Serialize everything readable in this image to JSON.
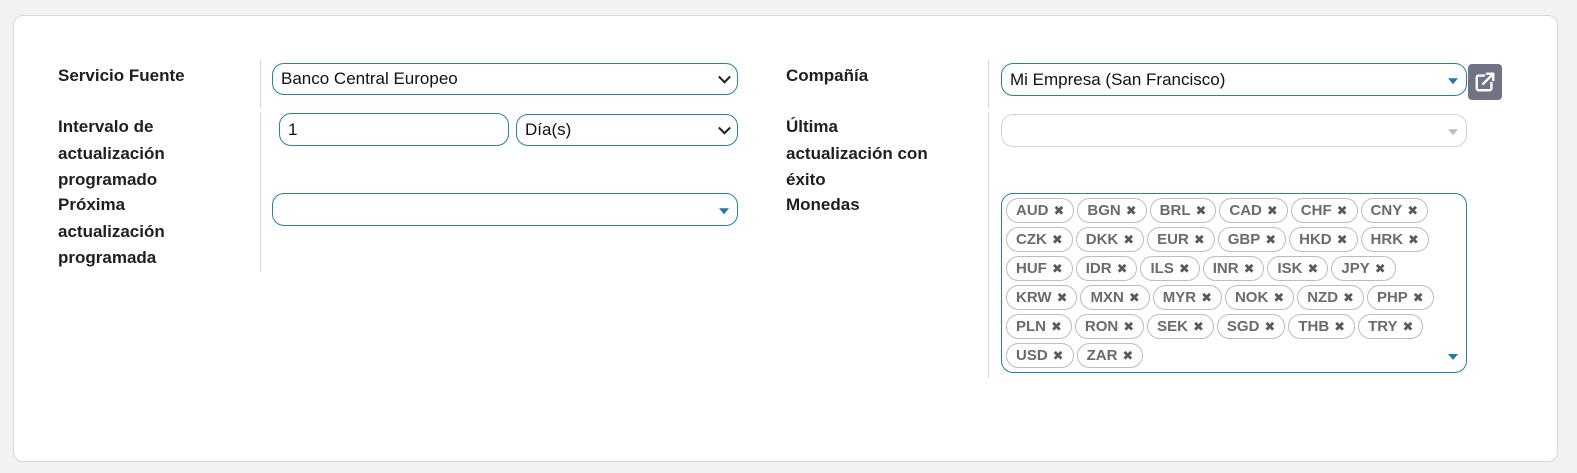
{
  "left": {
    "source_service": {
      "label": "Servicio Fuente",
      "value": "Banco Central Europeo"
    },
    "interval": {
      "label_line1": "Intervalo de",
      "label_line2": "actualización",
      "label_line3": "programado",
      "number_value": "1",
      "unit_value": "Día(s)"
    },
    "next_update": {
      "label_line1": "Próxima",
      "label_line2": "actualización",
      "label_line3": "programada",
      "value": ""
    }
  },
  "right": {
    "company": {
      "label": "Compañía",
      "value": "Mi Empresa (San Francisco)",
      "external_link_icon": "external-link-icon"
    },
    "last_success": {
      "label_line1": "Última",
      "label_line2": "actualización con",
      "label_line3": "éxito",
      "value": ""
    },
    "currencies": {
      "label": "Monedas",
      "remove_glyph": "✖",
      "tags": [
        "AUD",
        "BGN",
        "BRL",
        "CAD",
        "CHF",
        "CNY",
        "CZK",
        "DKK",
        "EUR",
        "GBP",
        "HKD",
        "HRK",
        "HUF",
        "IDR",
        "ILS",
        "INR",
        "ISK",
        "JPY",
        "KRW",
        "MXN",
        "MYR",
        "NOK",
        "NZD",
        "PHP",
        "PLN",
        "RON",
        "SEK",
        "SGD",
        "THB",
        "TRY",
        "USD",
        "ZAR"
      ]
    }
  },
  "colors": {
    "accent": "#2a7fa8",
    "button_bg": "#6f7383"
  }
}
